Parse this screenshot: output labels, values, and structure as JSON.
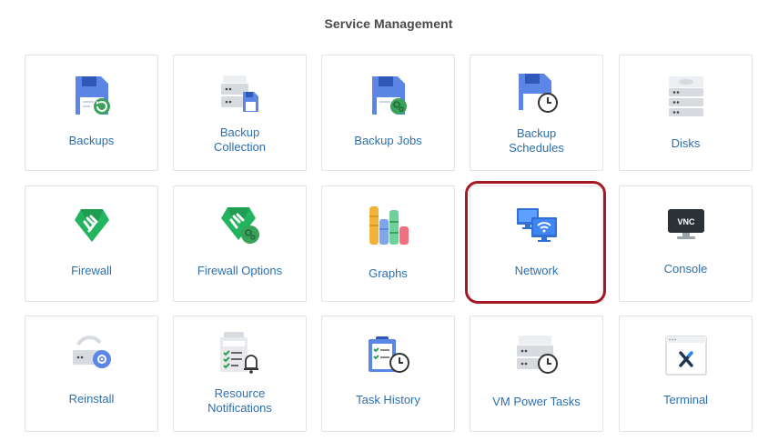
{
  "page": {
    "title": "Service Management"
  },
  "tiles": {
    "backups": "Backups",
    "backup_collection": "Backup Collection",
    "backup_jobs": "Backup Jobs",
    "backup_schedules": "Backup Schedules",
    "disks": "Disks",
    "firewall": "Firewall",
    "firewall_options": "Firewall Options",
    "graphs": "Graphs",
    "network": "Network",
    "console": "Console",
    "reinstall": "Reinstall",
    "resource_notifications": "Resource Notifications",
    "task_history": "Task History",
    "vm_power_tasks": "VM Power Tasks",
    "terminal": "Terminal"
  },
  "icons": {
    "vnc_text": "VNC"
  },
  "colors": {
    "label": "#2c6fad",
    "floppy_blue": "#5b86e5",
    "firewall_green": "#23b45f",
    "highlight_ring": "#a31a24"
  }
}
